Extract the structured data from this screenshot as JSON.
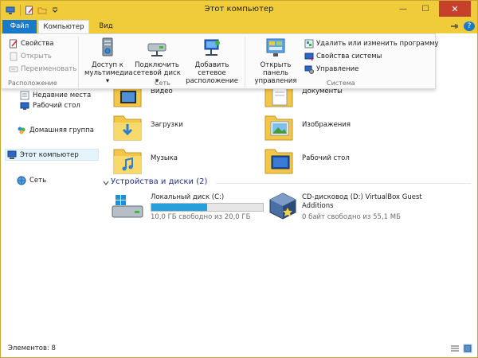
{
  "window": {
    "title": "Этот компьютер",
    "minimize_glyph": "—",
    "maximize_glyph": "☐",
    "close_glyph": "✕"
  },
  "menu": {
    "tabs": [
      "Файл",
      "Компьютер",
      "Вид"
    ],
    "active_tab": "Компьютер",
    "help_glyph": "?"
  },
  "ribbon": {
    "location_group": {
      "label": "Расположение",
      "properties": "Свойства",
      "open": "Открыть",
      "rename": "Переименовать"
    },
    "network_group": {
      "label": "Сеть",
      "media_access": [
        "Доступ к",
        "мультимедиа ▾"
      ],
      "map_drive": [
        "Подключить",
        "сетевой диск ▾"
      ],
      "add_location": [
        "Добавить сетевое",
        "расположение"
      ]
    },
    "system_group": {
      "label": "Система",
      "control_panel": [
        "Открыть панель",
        "управления"
      ],
      "uninstall": "Удалить или изменить программу",
      "system_properties": "Свойства системы",
      "manage": "Управление"
    }
  },
  "nav": {
    "recent": "Недавние места",
    "desktop": "Рабочий стол",
    "homegroup": "Домашняя группа",
    "this_pc": "Этот компьютер",
    "network": "Сеть"
  },
  "folders": [
    {
      "name": "Видео",
      "icon": "video-folder-icon"
    },
    {
      "name": "Документы",
      "icon": "documents-folder-icon"
    },
    {
      "name": "Загрузки",
      "icon": "downloads-folder-icon"
    },
    {
      "name": "Изображения",
      "icon": "pictures-folder-icon"
    },
    {
      "name": "Музыка",
      "icon": "music-folder-icon"
    },
    {
      "name": "Рабочий стол",
      "icon": "desktop-folder-icon"
    }
  ],
  "devices": {
    "header": "Устройства и диски (2)",
    "local_disk": {
      "name": "Локальный диск (C:)",
      "free": "10,0 ГБ свободно из 20,0 ГБ",
      "used_fraction": 0.5
    },
    "cd_drive": {
      "name_line1": "CD-дисковод (D:) VirtualBox Guest",
      "name_line2": "Additions",
      "free": "0 байт свободно из 55,1 МБ"
    }
  },
  "status": {
    "items": "Элементов: 8"
  },
  "colors": {
    "titlebar": "#f1cc3a",
    "file_tab": "#1979ca",
    "accent_blue": "#26a0da",
    "section_title": "#1e3287"
  }
}
